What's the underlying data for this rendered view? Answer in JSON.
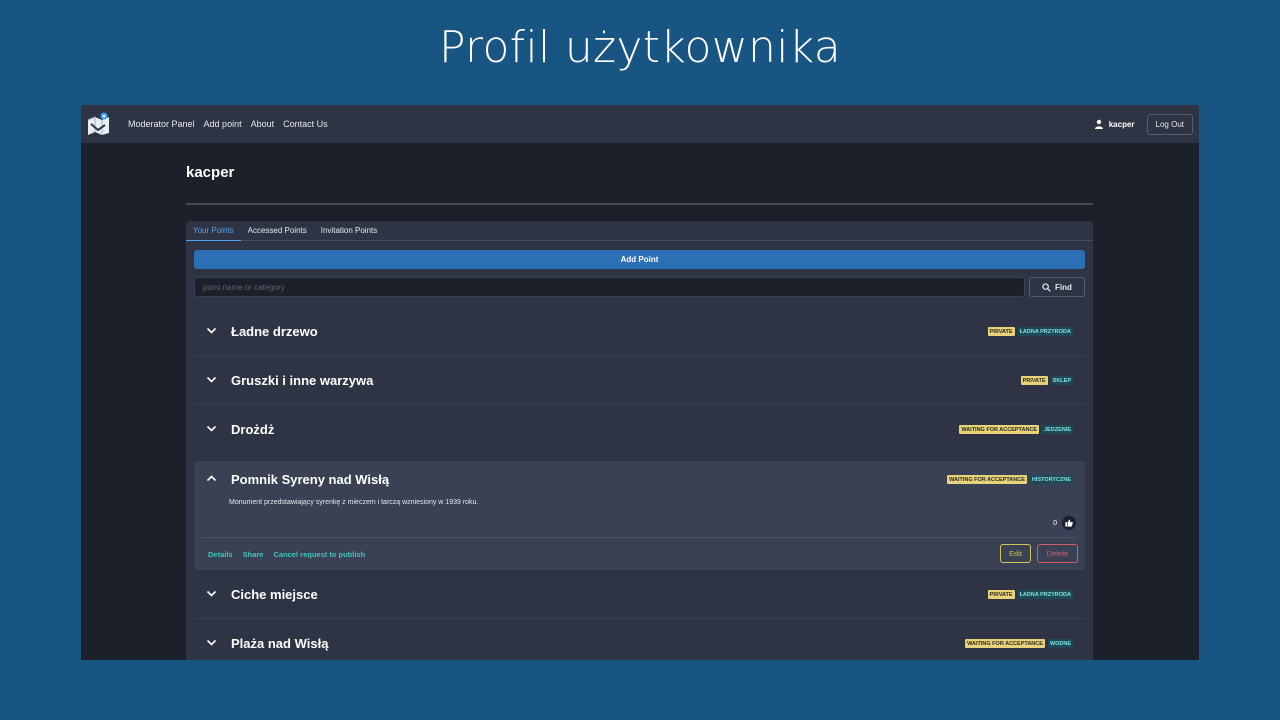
{
  "slide": {
    "title": "Profil użytkownika"
  },
  "navbar": {
    "links": [
      "Moderator Panel",
      "Add point",
      "About",
      "Contact Us"
    ],
    "username": "kacper",
    "logout_label": "Log Out"
  },
  "profile": {
    "name": "kacper"
  },
  "tabs": [
    {
      "label": "Your Points",
      "active": true
    },
    {
      "label": "Accessed Points",
      "active": false
    },
    {
      "label": "Invitation Points",
      "active": false
    }
  ],
  "add_point_label": "Add Point",
  "search": {
    "placeholder": "point name or category",
    "value": "",
    "find_label": "Find"
  },
  "points": [
    {
      "title": "Ładne drzewo",
      "badges": [
        "PRIVATE",
        "ŁADNA PRZYRODA"
      ],
      "expanded": false
    },
    {
      "title": "Gruszki i inne warzywa",
      "badges": [
        "PRIVATE",
        "SKLEP"
      ],
      "expanded": false
    },
    {
      "title": "Drożdż",
      "badges": [
        "WAITING FOR ACCEPTANCE",
        "JEDZENIE"
      ],
      "expanded": false
    },
    {
      "title": "Pomnik Syreny nad Wisłą",
      "badges": [
        "WAITING FOR ACCEPTANCE",
        "HISTORYCZNE"
      ],
      "expanded": true,
      "description": "Monument przedstawiający syrenkę z mieczem i tarczą wzniesiony w 1939 roku.",
      "likes": "0",
      "actions": [
        "Details",
        "Share",
        "Cancel request to publish"
      ],
      "edit_label": "Edit",
      "delete_label": "Delete"
    },
    {
      "title": "Ciche miejsce",
      "badges": [
        "PRIVATE",
        "ŁADNA PRZYRODA"
      ],
      "expanded": false
    },
    {
      "title": "Plaża nad Wisłą",
      "badges": [
        "WAITING FOR ACCEPTANCE",
        "WODNE"
      ],
      "expanded": false
    }
  ],
  "colors": {
    "background": "#185583",
    "navbar": "#2e3444",
    "page": "#1b202b",
    "primary": "#2d6fb5",
    "badge_status": "#e8d27a",
    "badge_category": "#1f4a55",
    "link": "#3ec6b8"
  }
}
